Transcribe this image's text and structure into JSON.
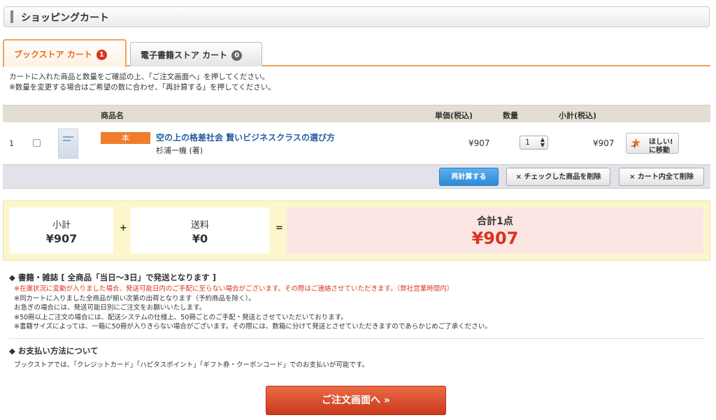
{
  "header": {
    "title": "ショッピングカート"
  },
  "tabs": [
    {
      "label": "ブックストア カート",
      "count": "1"
    },
    {
      "label": "電子書籍ストア カート",
      "count": "0"
    }
  ],
  "notes": [
    "カートに入れた商品と数量をご確認の上、「ご注文画面へ」を押してください。",
    "※数量を変更する場合はご希望の数に合わせ、「再計算する」を押してください。"
  ],
  "table": {
    "headers": {
      "name": "商品名",
      "unit_price": "単価(税込)",
      "quantity": "数量",
      "subtotal": "小計(税込)"
    },
    "rows": [
      {
        "num": "1",
        "type": "本",
        "title": "空の上の格差社会 賢いビジネスクラスの選び方",
        "author": "杉浦一機 (著)",
        "price": "¥907",
        "quantity": "1",
        "subtotal": "¥907",
        "wish_line1": "ほしい!",
        "wish_line2": "に移動"
      }
    ]
  },
  "actions": {
    "recalc": "再計算する",
    "delete_checked": "× チェックした商品を削除",
    "delete_all": "× カート内全て削除"
  },
  "summary": {
    "subtotal_label": "小計",
    "subtotal_value": "¥907",
    "plus": "+",
    "shipping_label": "送料",
    "shipping_value": "¥0",
    "equals": "=",
    "total_label": "合計1点",
    "total_value": "¥907"
  },
  "shipping": {
    "title": "◆ 書籍・雑誌 [ 全商品「当日〜3日」で発送となります ]",
    "notes": [
      "※在庫状況に変動が入りました場合、発送可能日内のご手配に至らない場合がございます。その際はご連絡させていただきます。（弊社営業時間内）",
      "※同カートに入りました全商品が揃い次第の出荷となります（予約商品を除く）。",
      "お急ぎの場合には、発送可能日別にご注文をお願いいたします。",
      "※50冊以上ご注文の場合には、配送システムの仕様上、50冊ごとのご手配・発送とさせていただいております。",
      "※書籍サイズによっては、一箱に50冊が入りきらない場合がございます。その際には、数箱に分けて発送とさせていただきますのであらかじめご了承ください。"
    ]
  },
  "payment": {
    "title": "◆ お支払い方法について",
    "text": "ブックストアでは、「クレジットカード」「ハピタスポイント」「ギフト券・クーポンコード」でのお支払いが可能です。"
  },
  "order_button": "ご注文画面へ »",
  "colors": {
    "accent": "#ef7d2c",
    "price_red": "#d9341e",
    "link_blue": "#245e9d"
  }
}
